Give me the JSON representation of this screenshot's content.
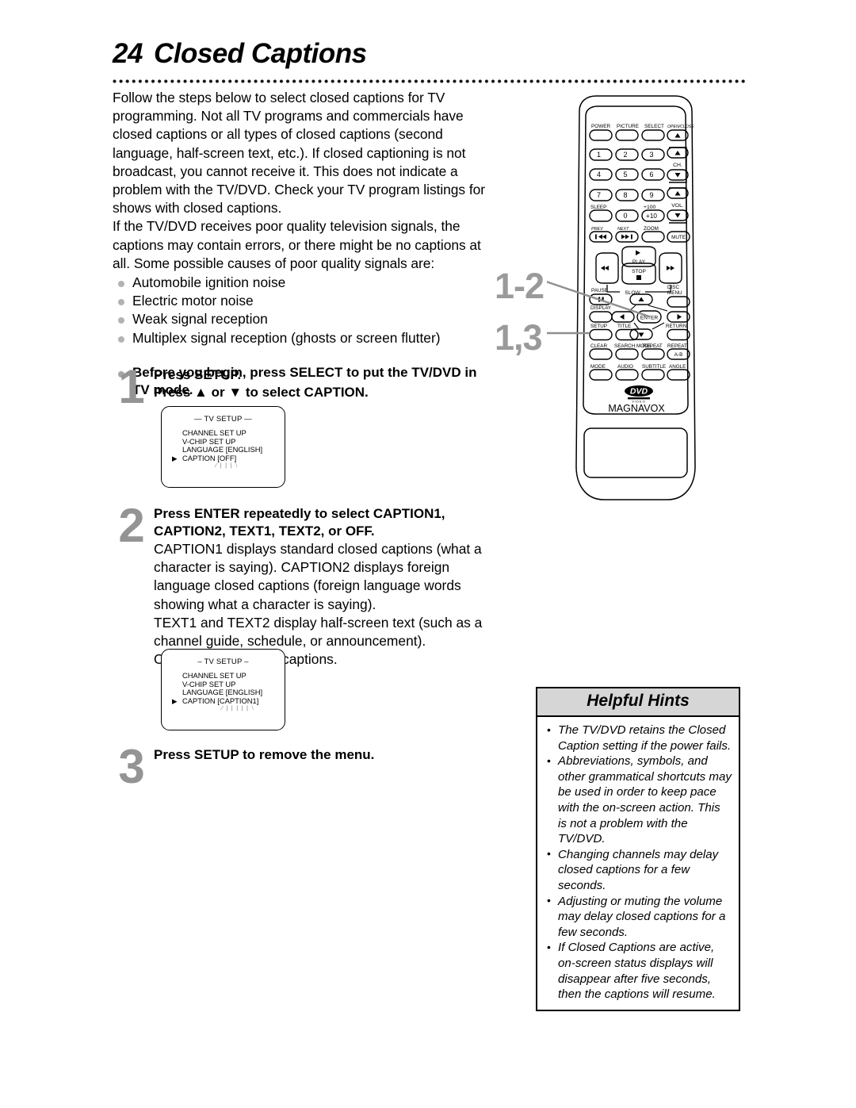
{
  "page": {
    "number": "24",
    "title": "Closed Captions"
  },
  "intro": {
    "paragraph1": "Follow the steps below to select closed captions for TV programming. Not all TV programs and commercials have closed captions or all types of closed captions (second language, half-screen text, etc.). If closed captioning is not broadcast, you cannot receive it. This does not indicate a problem with the TV/DVD. Check your TV program listings for shows with closed captions.",
    "paragraph2": "If the TV/DVD receives poor quality television signals, the captions may contain errors, or there might be no captions at all. Some possible causes of poor quality signals are:",
    "causes": [
      "Automobile ignition noise",
      "Electric motor noise",
      "Weak signal reception",
      "Multiplex signal reception (ghosts or screen flutter)"
    ],
    "note": "Before you begin, press SELECT to put the TV/DVD in TV mode."
  },
  "steps": [
    {
      "number": "1",
      "heading_line1": "Press SETUP.",
      "heading_line2": "Press ▲ or ▼ to select CAPTION.",
      "body": ""
    },
    {
      "number": "2",
      "heading_line1": "Press ENTER repeatedly to select CAPTION1,",
      "heading_line2": "CAPTION2, TEXT1, TEXT2, or OFF.",
      "body_p1": "CAPTION1 displays standard closed captions (what a character is saying). CAPTION2 displays foreign language closed captions (foreign language words showing what a character is saying).",
      "body_p2": "TEXT1 and TEXT2 display half-screen text (such as a channel guide, schedule, or announcement).",
      "body_p3": "OFF turns off closed captions."
    },
    {
      "number": "3",
      "heading_line1": "Press SETUP to remove the menu.",
      "heading_line2": "",
      "body": ""
    }
  ],
  "osd_screens": [
    {
      "title": "— TV SETUP —",
      "items": [
        {
          "label": "CHANNEL SET UP",
          "value": "",
          "selected": false
        },
        {
          "label": "V-CHIP SET UP",
          "value": "",
          "selected": false
        },
        {
          "label": "LANGUAGE",
          "value": "[ENGLISH]",
          "selected": false
        },
        {
          "label": "CAPTION",
          "value": "[OFF]",
          "selected": true
        }
      ],
      "blink_rays": "⁄ | | | ⧵"
    },
    {
      "title": "– TV SETUP –",
      "items": [
        {
          "label": "CHANNEL SET UP",
          "value": "",
          "selected": false
        },
        {
          "label": "V-CHIP SET UP",
          "value": "",
          "selected": false
        },
        {
          "label": "LANGUAGE",
          "value": "[ENGLISH]",
          "selected": false
        },
        {
          "label": "CAPTION",
          "value": "[CAPTION1]",
          "selected": true
        }
      ],
      "blink_rays": "⁄ | | | | | ⧵"
    }
  ],
  "callouts": [
    {
      "label": "1-2",
      "points_to": "enter-button"
    },
    {
      "label": "1,3",
      "points_to": "setup-button"
    }
  ],
  "remote": {
    "brand": "MAGNAVOX",
    "logo": "DVD",
    "logo_sub": "VIDEO",
    "row_power": [
      "POWER",
      "PICTURE",
      "SELECT",
      "OPEN/CLOSE"
    ],
    "keypad": [
      "1",
      "2",
      "3",
      "4",
      "5",
      "6",
      "7",
      "8",
      "9",
      "0",
      "+10"
    ],
    "keypad_extra": {
      "sleep": "SLEEP",
      "plus100": "+100"
    },
    "ch_label": "CH.",
    "vol_label": "VOL.",
    "prev_label": "PREV",
    "next_label": "NEXT",
    "zoom_label": "ZOOM",
    "mute_label": "MUTE",
    "play_label": "PLAY",
    "stop_label": "STOP",
    "slow_label": "SLOW",
    "pause_label": "PAUSE",
    "disc_menu_label1": "DISC",
    "disc_menu_label2": "MENU",
    "display_label": "DISPLAY",
    "enter_label": "ENTER",
    "setup_label": "SETUP",
    "title_label": "TITLE",
    "return_label": "RETURN",
    "clear_label": "CLEAR",
    "search_mode_label": "SEARCH MODE",
    "repeat_label": "REPEAT",
    "repeat_ab_label": "REPEAT",
    "ab_label": "A-B",
    "mode_label": "MODE",
    "audio_label": "AUDIO",
    "subtitle_label": "SUBTITLE",
    "angle_label": "ANGLE"
  },
  "hints": {
    "title": "Helpful Hints",
    "items": [
      "The TV/DVD retains the Closed Caption setting if the power fails.",
      "Abbreviations, symbols, and other grammatical shortcuts may be used in order to keep pace with the on-screen action. This is not a problem with the TV/DVD.",
      "Changing channels may delay closed captions for a few seconds.",
      "Adjusting or muting the volume may delay closed captions for a few seconds.",
      "If Closed Captions are active, on-screen status displays will disappear after five seconds, then the captions will resume."
    ]
  },
  "colors": {
    "step_number": "#949494",
    "callout": "#9a9a9a",
    "bullet": "#b3b3b3",
    "hints_header_bg": "#d6d6d6"
  }
}
